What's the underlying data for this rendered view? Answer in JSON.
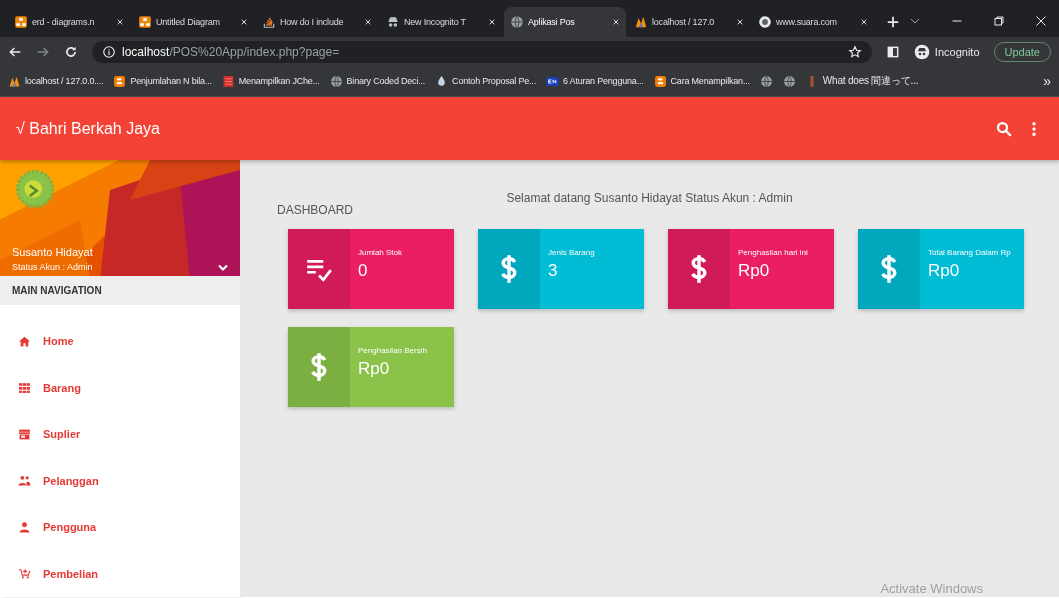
{
  "browser": {
    "tabs": [
      {
        "title": "erd - diagrams.n",
        "selected": false,
        "kind": "drawio"
      },
      {
        "title": "Untitled Diagram",
        "selected": false,
        "kind": "drawio"
      },
      {
        "title": "How do I include",
        "selected": false,
        "kind": "stack"
      },
      {
        "title": "New Incognito T",
        "selected": false,
        "kind": "incognito"
      },
      {
        "title": "Aplikasi Pos",
        "selected": true,
        "kind": "globe"
      },
      {
        "title": "localhost / 127.0",
        "selected": false,
        "kind": "pma"
      },
      {
        "title": "www.suara.com",
        "selected": false,
        "kind": "suara"
      }
    ],
    "address": {
      "host": "localhost",
      "path": "/POS%20App/index.php?page="
    },
    "profile": "Incognito",
    "update_button": "Update",
    "bookmarks": [
      {
        "title": "localhost / 127.0.0....",
        "kind": "pma"
      },
      {
        "title": "Penjumlahan N bila...",
        "kind": "blogger"
      },
      {
        "title": "Menampilkan JChe...",
        "kind": "red"
      },
      {
        "title": "Binary Coded Deci...",
        "kind": "globe"
      },
      {
        "title": "Contoh Proposal Pe...",
        "kind": "drop"
      },
      {
        "title": "6 Aturan Pengguna...",
        "kind": "en"
      },
      {
        "title": "Cara Menampilkan...",
        "kind": "blogger"
      },
      {
        "kind": "globe"
      },
      {
        "kind": "globe"
      },
      {
        "title": "What does 間違って...",
        "kind": "bar"
      }
    ],
    "more_bookmarks": "»"
  },
  "app_bar": {
    "title": "√ Bahri Berkah Jaya"
  },
  "sidebar": {
    "user_name": "Susanto Hidayat",
    "user_status": "Status Akun : Admin",
    "section_header": "MAIN NAVIGATION",
    "items": [
      {
        "label": "Home",
        "kind": "home"
      },
      {
        "label": "Barang",
        "kind": "grid"
      },
      {
        "label": "Suplier",
        "kind": "store"
      },
      {
        "label": "Pelanggan",
        "kind": "people"
      },
      {
        "label": "Pengguna",
        "kind": "person"
      },
      {
        "label": "Pembelian",
        "kind": "cart"
      }
    ]
  },
  "content": {
    "title": "DASHBOARD",
    "welcome": "Selamat datang Susanto Hidayat Status Akun : Admin",
    "cards": [
      {
        "label": "Jumlah Stok",
        "value": "0",
        "color": "#e91e63",
        "kind": "list-check"
      },
      {
        "label": "Jenis Barang",
        "value": "3",
        "color": "#00bcd4",
        "kind": "dollar"
      },
      {
        "label": "Penghasilan hari ini",
        "value": "Rp0",
        "color": "#e91e63",
        "kind": "dollar"
      },
      {
        "label": "Total Barang Dalam Rp",
        "value": "Rp0",
        "color": "#00bcd4",
        "kind": "dollar"
      },
      {
        "label": "Penghasilan Bersih",
        "value": "Rp0",
        "color": "#8bc34a",
        "kind": "dollar"
      }
    ]
  },
  "os_notice": "Activate Windows"
}
